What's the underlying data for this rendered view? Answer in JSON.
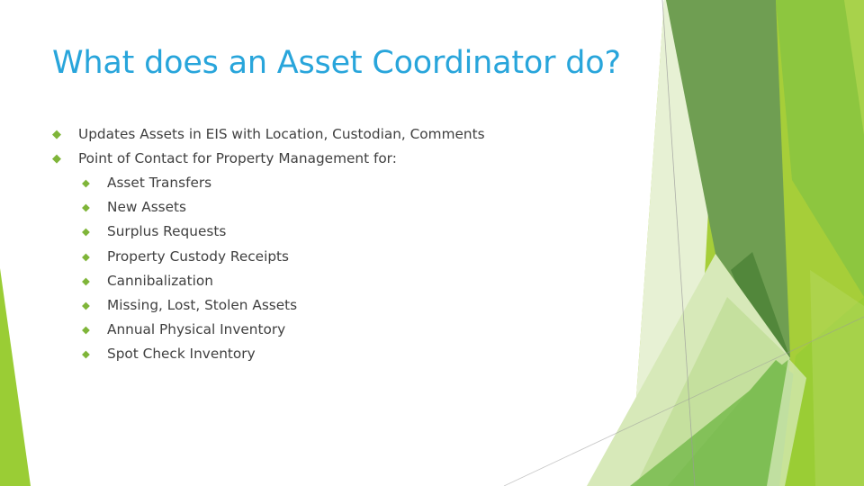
{
  "slide": {
    "title": "What does an Asset Coordinator do?",
    "title_color": "#28A5DB",
    "background_color": "#FFFFFF",
    "body_text_color": "#404040",
    "bullet_color": "#7FB539",
    "bullet_glyph": "◆"
  },
  "content": {
    "bullets": [
      {
        "level": 1,
        "text": "Updates Assets in EIS with Location, Custodian, Comments"
      },
      {
        "level": 1,
        "text": "Point of Contact for Property Management for:"
      },
      {
        "level": 2,
        "text": "Asset Transfers"
      },
      {
        "level": 2,
        "text": "New Assets"
      },
      {
        "level": 2,
        "text": "Surplus Requests"
      },
      {
        "level": 2,
        "text": "Property Custody Receipts"
      },
      {
        "level": 2,
        "text": "Cannibalization"
      },
      {
        "level": 2,
        "text": "Missing, Lost, Stolen Assets"
      },
      {
        "level": 2,
        "text": "Annual Physical Inventory"
      },
      {
        "level": 2,
        "text": "Spot Check Inventory"
      }
    ]
  },
  "decoration": {
    "name": "facet-theme-green-polygons",
    "palette": {
      "dark_olive": "#6F9E52",
      "dark_green": "#5E9644",
      "mid_green": "#7EBE55",
      "bright_green": "#8DC63F",
      "yellow_green": "#9ACD35",
      "lime": "#A6CE39",
      "pale_green": "#D7E9B9",
      "very_pale_green": "#E7F1D4",
      "soft_green": "#C3DF9B",
      "hairline": "#9A9A9A"
    }
  }
}
